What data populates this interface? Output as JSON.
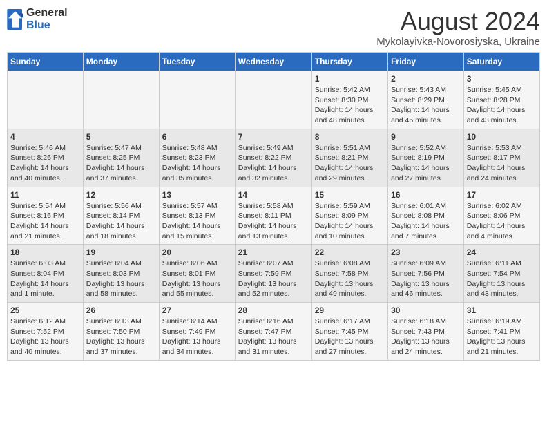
{
  "logo": {
    "general": "General",
    "blue": "Blue"
  },
  "title": "August 2024",
  "subtitle": "Mykolayivka-Novorosiyska, Ukraine",
  "days_of_week": [
    "Sunday",
    "Monday",
    "Tuesday",
    "Wednesday",
    "Thursday",
    "Friday",
    "Saturday"
  ],
  "weeks": [
    [
      {
        "num": "",
        "info": ""
      },
      {
        "num": "",
        "info": ""
      },
      {
        "num": "",
        "info": ""
      },
      {
        "num": "",
        "info": ""
      },
      {
        "num": "1",
        "info": "Sunrise: 5:42 AM\nSunset: 8:30 PM\nDaylight: 14 hours and 48 minutes."
      },
      {
        "num": "2",
        "info": "Sunrise: 5:43 AM\nSunset: 8:29 PM\nDaylight: 14 hours and 45 minutes."
      },
      {
        "num": "3",
        "info": "Sunrise: 5:45 AM\nSunset: 8:28 PM\nDaylight: 14 hours and 43 minutes."
      }
    ],
    [
      {
        "num": "4",
        "info": "Sunrise: 5:46 AM\nSunset: 8:26 PM\nDaylight: 14 hours and 40 minutes."
      },
      {
        "num": "5",
        "info": "Sunrise: 5:47 AM\nSunset: 8:25 PM\nDaylight: 14 hours and 37 minutes."
      },
      {
        "num": "6",
        "info": "Sunrise: 5:48 AM\nSunset: 8:23 PM\nDaylight: 14 hours and 35 minutes."
      },
      {
        "num": "7",
        "info": "Sunrise: 5:49 AM\nSunset: 8:22 PM\nDaylight: 14 hours and 32 minutes."
      },
      {
        "num": "8",
        "info": "Sunrise: 5:51 AM\nSunset: 8:21 PM\nDaylight: 14 hours and 29 minutes."
      },
      {
        "num": "9",
        "info": "Sunrise: 5:52 AM\nSunset: 8:19 PM\nDaylight: 14 hours and 27 minutes."
      },
      {
        "num": "10",
        "info": "Sunrise: 5:53 AM\nSunset: 8:17 PM\nDaylight: 14 hours and 24 minutes."
      }
    ],
    [
      {
        "num": "11",
        "info": "Sunrise: 5:54 AM\nSunset: 8:16 PM\nDaylight: 14 hours and 21 minutes."
      },
      {
        "num": "12",
        "info": "Sunrise: 5:56 AM\nSunset: 8:14 PM\nDaylight: 14 hours and 18 minutes."
      },
      {
        "num": "13",
        "info": "Sunrise: 5:57 AM\nSunset: 8:13 PM\nDaylight: 14 hours and 15 minutes."
      },
      {
        "num": "14",
        "info": "Sunrise: 5:58 AM\nSunset: 8:11 PM\nDaylight: 14 hours and 13 minutes."
      },
      {
        "num": "15",
        "info": "Sunrise: 5:59 AM\nSunset: 8:09 PM\nDaylight: 14 hours and 10 minutes."
      },
      {
        "num": "16",
        "info": "Sunrise: 6:01 AM\nSunset: 8:08 PM\nDaylight: 14 hours and 7 minutes."
      },
      {
        "num": "17",
        "info": "Sunrise: 6:02 AM\nSunset: 8:06 PM\nDaylight: 14 hours and 4 minutes."
      }
    ],
    [
      {
        "num": "18",
        "info": "Sunrise: 6:03 AM\nSunset: 8:04 PM\nDaylight: 14 hours and 1 minute."
      },
      {
        "num": "19",
        "info": "Sunrise: 6:04 AM\nSunset: 8:03 PM\nDaylight: 13 hours and 58 minutes."
      },
      {
        "num": "20",
        "info": "Sunrise: 6:06 AM\nSunset: 8:01 PM\nDaylight: 13 hours and 55 minutes."
      },
      {
        "num": "21",
        "info": "Sunrise: 6:07 AM\nSunset: 7:59 PM\nDaylight: 13 hours and 52 minutes."
      },
      {
        "num": "22",
        "info": "Sunrise: 6:08 AM\nSunset: 7:58 PM\nDaylight: 13 hours and 49 minutes."
      },
      {
        "num": "23",
        "info": "Sunrise: 6:09 AM\nSunset: 7:56 PM\nDaylight: 13 hours and 46 minutes."
      },
      {
        "num": "24",
        "info": "Sunrise: 6:11 AM\nSunset: 7:54 PM\nDaylight: 13 hours and 43 minutes."
      }
    ],
    [
      {
        "num": "25",
        "info": "Sunrise: 6:12 AM\nSunset: 7:52 PM\nDaylight: 13 hours and 40 minutes."
      },
      {
        "num": "26",
        "info": "Sunrise: 6:13 AM\nSunset: 7:50 PM\nDaylight: 13 hours and 37 minutes."
      },
      {
        "num": "27",
        "info": "Sunrise: 6:14 AM\nSunset: 7:49 PM\nDaylight: 13 hours and 34 minutes."
      },
      {
        "num": "28",
        "info": "Sunrise: 6:16 AM\nSunset: 7:47 PM\nDaylight: 13 hours and 31 minutes."
      },
      {
        "num": "29",
        "info": "Sunrise: 6:17 AM\nSunset: 7:45 PM\nDaylight: 13 hours and 27 minutes."
      },
      {
        "num": "30",
        "info": "Sunrise: 6:18 AM\nSunset: 7:43 PM\nDaylight: 13 hours and 24 minutes."
      },
      {
        "num": "31",
        "info": "Sunrise: 6:19 AM\nSunset: 7:41 PM\nDaylight: 13 hours and 21 minutes."
      }
    ]
  ]
}
